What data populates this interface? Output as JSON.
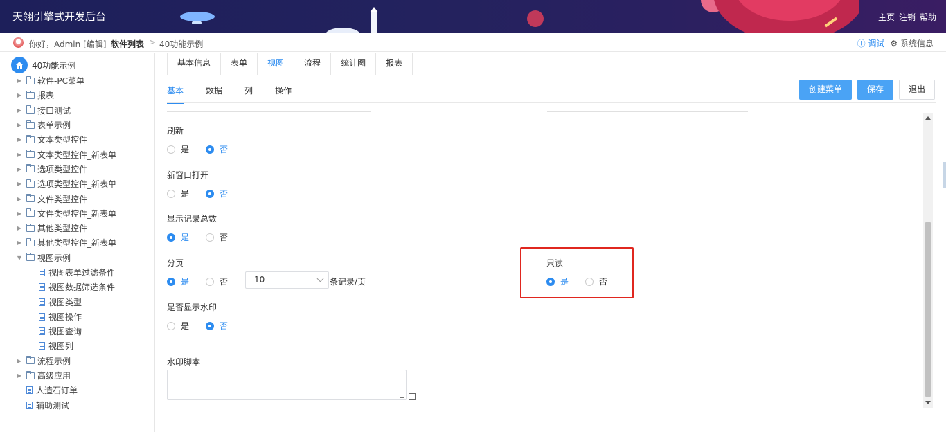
{
  "header": {
    "title": "天翎引擎式开发后台",
    "links": [
      "主页",
      "注销",
      "帮助"
    ]
  },
  "breadcrumb": {
    "greeting": "你好，Admin [编辑]",
    "level1": "软件列表",
    "separator": ">",
    "level2": "40功能示例",
    "debug": "ⓘ 调试",
    "sysinfo": "⚙ 系统信息"
  },
  "sidebar": {
    "root": "40功能示例",
    "items": [
      {
        "label": "软件-PC菜单",
        "type": "folder",
        "level": 1,
        "arrow": "▶"
      },
      {
        "label": "报表",
        "type": "folder",
        "level": 1,
        "arrow": "▶"
      },
      {
        "label": "接口测试",
        "type": "folder",
        "level": 1,
        "arrow": "▶"
      },
      {
        "label": "表单示例",
        "type": "folder",
        "level": 1,
        "arrow": "▶"
      },
      {
        "label": "文本类型控件",
        "type": "folder",
        "level": 1,
        "arrow": "▶"
      },
      {
        "label": "文本类型控件_新表单",
        "type": "folder",
        "level": 1,
        "arrow": "▶"
      },
      {
        "label": "选项类型控件",
        "type": "folder",
        "level": 1,
        "arrow": "▶"
      },
      {
        "label": "选项类型控件_新表单",
        "type": "folder",
        "level": 1,
        "arrow": "▶"
      },
      {
        "label": "文件类型控件",
        "type": "folder",
        "level": 1,
        "arrow": "▶"
      },
      {
        "label": "文件类型控件_新表单",
        "type": "folder",
        "level": 1,
        "arrow": "▶"
      },
      {
        "label": "其他类型控件",
        "type": "folder",
        "level": 1,
        "arrow": "▶"
      },
      {
        "label": "其他类型控件_新表单",
        "type": "folder",
        "level": 1,
        "arrow": "▶"
      },
      {
        "label": "视图示例",
        "type": "folder",
        "level": 1,
        "arrow": "▼"
      },
      {
        "label": "视图表单过滤条件",
        "type": "file",
        "level": 2,
        "arrow": ""
      },
      {
        "label": "视图数据筛选条件",
        "type": "file",
        "level": 2,
        "arrow": ""
      },
      {
        "label": "视图类型",
        "type": "file",
        "level": 2,
        "arrow": ""
      },
      {
        "label": "视图操作",
        "type": "file",
        "level": 2,
        "arrow": ""
      },
      {
        "label": "视图查询",
        "type": "file",
        "level": 2,
        "arrow": ""
      },
      {
        "label": "视图列",
        "type": "file",
        "level": 2,
        "arrow": ""
      },
      {
        "label": "流程示例",
        "type": "folder",
        "level": 1,
        "arrow": "▶"
      },
      {
        "label": "高级应用",
        "type": "folder",
        "level": 1,
        "arrow": "▶"
      },
      {
        "label": "人造石订单",
        "type": "file",
        "level": 1,
        "arrow": ""
      },
      {
        "label": "辅助测试",
        "type": "file",
        "level": 1,
        "arrow": ""
      }
    ]
  },
  "tabs_top": [
    {
      "label": "基本信息",
      "active": false
    },
    {
      "label": "表单",
      "active": false
    },
    {
      "label": "视图",
      "active": true
    },
    {
      "label": "流程",
      "active": false
    },
    {
      "label": "统计图",
      "active": false
    },
    {
      "label": "报表",
      "active": false
    }
  ],
  "tabs_sub": [
    {
      "label": "基本",
      "active": true
    },
    {
      "label": "数据",
      "active": false
    },
    {
      "label": "列",
      "active": false
    },
    {
      "label": "操作",
      "active": false
    }
  ],
  "actions": {
    "create_menu": "创建菜单",
    "save": "保存",
    "exit": "退出"
  },
  "form": {
    "refresh": {
      "label": "刷新",
      "yes": "是",
      "no": "否",
      "value": "no"
    },
    "new_window": {
      "label": "新窗口打开",
      "yes": "是",
      "no": "否",
      "value": "no"
    },
    "show_total": {
      "label": "显示记录总数",
      "yes": "是",
      "no": "否",
      "value": "yes"
    },
    "paging": {
      "label": "分页",
      "yes": "是",
      "no": "否",
      "value": "yes",
      "page_size": "10",
      "suffix": "条记录/页"
    },
    "watermark": {
      "label": "是否显示水印",
      "yes": "是",
      "no": "否",
      "value": "no"
    },
    "readonly": {
      "label": "只读",
      "yes": "是",
      "no": "否",
      "value": "yes"
    },
    "watermark_script": {
      "label": "水印脚本",
      "value": ""
    }
  },
  "colors": {
    "accent": "#2d8cf0",
    "primary_button": "#4aa3f5",
    "highlight": "#e0271f",
    "header_bg": "#1d1f5a"
  }
}
